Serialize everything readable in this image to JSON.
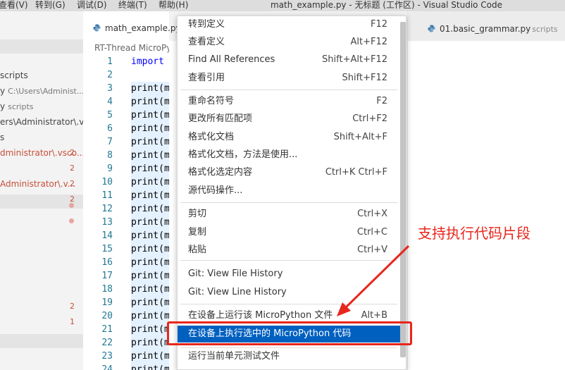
{
  "menubar": {
    "items": [
      "查看(V)",
      "转到(G)",
      "调试(D)",
      "终端(T)",
      "帮助(H)"
    ],
    "window_title": "math_example.py - 无标题 (工作区) - Visual Studio Code"
  },
  "tabs": {
    "active": "math_example.py",
    "right_label": "01.basic_grammar.py",
    "right_desc": "scripts"
  },
  "breadcrumb": "RT-Thread MicroPy",
  "sidebar": {
    "rows": [
      {
        "text": "scripts",
        "desc": "",
        "badge": "",
        "red": false
      },
      {
        "text": "y",
        "desc": "C:\\Users\\Administ...",
        "badge": "",
        "red": false
      },
      {
        "text": "y",
        "desc": "scripts",
        "badge": "",
        "red": false
      },
      {
        "text": "ers\\Administrator\\.vs...",
        "desc": "",
        "badge": "",
        "red": false
      },
      {
        "text": "s",
        "desc": "",
        "badge": "",
        "red": false
      },
      {
        "text": "dministrator\\.vsco...",
        "desc": "",
        "badge": "2",
        "red": true
      },
      {
        "text": "",
        "desc": "",
        "badge": "2",
        "red": false
      },
      {
        "text": "Administrator\\.v...",
        "desc": "",
        "badge": "2",
        "red": true
      },
      {
        "text": "",
        "desc": "",
        "badge": "2",
        "red": false
      },
      {
        "text": "",
        "desc": "",
        "badge": "",
        "red": false
      },
      {
        "text": "",
        "desc": "",
        "badge": "2",
        "red": false
      },
      {
        "text": "",
        "desc": "",
        "badge": "1",
        "red": false
      }
    ]
  },
  "editor": {
    "lines": [
      {
        "n": "1",
        "code": "import",
        "kw": true
      },
      {
        "n": "2",
        "code": "",
        "kw": false
      },
      {
        "n": "3",
        "code": "print(m",
        "kw": false
      },
      {
        "n": "4",
        "code": "print(m",
        "kw": false
      },
      {
        "n": "5",
        "code": "print(m",
        "kw": false
      },
      {
        "n": "6",
        "code": "print(m",
        "kw": false
      },
      {
        "n": "7",
        "code": "print(m",
        "kw": false
      },
      {
        "n": "8",
        "code": "print(m",
        "kw": false
      },
      {
        "n": "9",
        "code": "print(m",
        "kw": false
      },
      {
        "n": "10",
        "code": "print(m",
        "kw": false
      },
      {
        "n": "11",
        "code": "print(m",
        "kw": false
      },
      {
        "n": "12",
        "code": "print(m",
        "kw": false
      },
      {
        "n": "13",
        "code": "print(m",
        "kw": false
      },
      {
        "n": "14",
        "code": "print(m",
        "kw": false
      },
      {
        "n": "15",
        "code": "print(m",
        "kw": false
      },
      {
        "n": "16",
        "code": "print(m",
        "kw": false
      },
      {
        "n": "17",
        "code": "print(m",
        "kw": false
      },
      {
        "n": "18",
        "code": "print(m",
        "kw": false
      },
      {
        "n": "19",
        "code": "print(m",
        "kw": false
      },
      {
        "n": "20",
        "code": "print(m",
        "kw": false
      },
      {
        "n": "21",
        "code": "print(m",
        "kw": false
      },
      {
        "n": "22",
        "code": "print(m",
        "kw": false
      },
      {
        "n": "23",
        "code": "print(m",
        "kw": false
      },
      {
        "n": "24",
        "code": "print(m",
        "kw": false
      }
    ]
  },
  "context_menu": {
    "items": [
      {
        "label": "转到定义",
        "key": "F12"
      },
      {
        "label": "查看定义",
        "key": "Alt+F12"
      },
      {
        "label": "Find All References",
        "key": "Shift+Alt+F12"
      },
      {
        "label": "查看引用",
        "key": "Shift+F12"
      },
      {
        "label": "重命名符号",
        "key": "F2"
      },
      {
        "label": "更改所有匹配项",
        "key": "Ctrl+F2"
      },
      {
        "label": "格式化文档",
        "key": "Shift+Alt+F"
      },
      {
        "label": "格式化文档，方法是使用...",
        "key": ""
      },
      {
        "label": "格式化选定内容",
        "key": "Ctrl+K Ctrl+F"
      },
      {
        "label": "源代码操作...",
        "key": ""
      },
      {
        "label": "剪切",
        "key": "Ctrl+X"
      },
      {
        "label": "复制",
        "key": "Ctrl+C"
      },
      {
        "label": "粘贴",
        "key": "Ctrl+V"
      },
      {
        "label": "Git: View File History",
        "key": ""
      },
      {
        "label": "Git: View Line History",
        "key": ""
      },
      {
        "label": "在设备上运行该 MicroPython 文件",
        "key": "Alt+B"
      },
      {
        "label": "在设备上执行选中的 MicroPython 代码",
        "key": ""
      },
      {
        "label": "运行当前单元测试文件",
        "key": ""
      }
    ],
    "selected_index": 16
  },
  "annotation": {
    "text": "支持执行代码片段",
    "color": "#e8261c"
  }
}
